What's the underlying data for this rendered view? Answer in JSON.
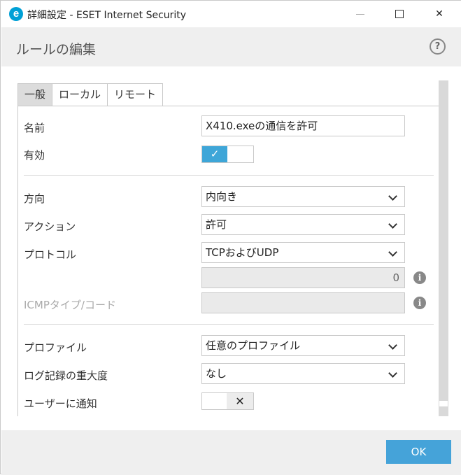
{
  "window": {
    "title": "詳細設定 - ESET Internet Security",
    "logo_letter": "e",
    "close_glyph": "✕"
  },
  "header": {
    "title": "ルールの編集",
    "help_glyph": "?"
  },
  "tabs": [
    {
      "label": "一般",
      "active": true
    },
    {
      "label": "ローカル",
      "active": false
    },
    {
      "label": "リモート",
      "active": false
    }
  ],
  "form": {
    "name": {
      "label": "名前",
      "value": "X410.exeの通信を許可"
    },
    "enabled": {
      "label": "有効",
      "value": true,
      "on_glyph": "✓"
    },
    "direction": {
      "label": "方向",
      "value": "内向き"
    },
    "action": {
      "label": "アクション",
      "value": "許可"
    },
    "protocol": {
      "label": "プロトコル",
      "value": "TCPおよびUDP",
      "number_value": "0"
    },
    "icmp": {
      "label": "ICMPタイプ/コード",
      "value": ""
    },
    "profile": {
      "label": "プロファイル",
      "value": "任意のプロファイル"
    },
    "log_severity": {
      "label": "ログ記録の重大度",
      "value": "なし"
    },
    "notify_user": {
      "label": "ユーザーに通知",
      "value": false,
      "off_glyph": "✕"
    },
    "info_glyph": "i"
  },
  "footer": {
    "ok_label": "OK"
  },
  "colors": {
    "accent": "#45a3d9",
    "toggle_on": "#3ea6d8",
    "brand": "#00a0d6"
  }
}
